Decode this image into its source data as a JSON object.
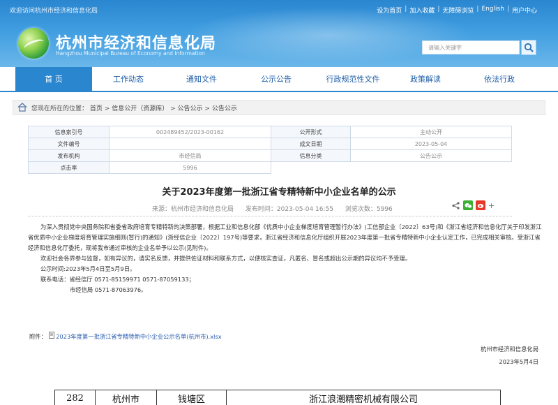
{
  "header": {
    "welcome": "欢迎访问杭州市经济和信息化局",
    "top_links": [
      "设为首页",
      "加入收藏",
      "无障碍浏览",
      "English",
      "用户中心"
    ],
    "title": "杭州市经济和信息化局",
    "subtitle": "Hangzhou Municipal Bureau of Economy and Information",
    "search_placeholder": "请输入关键字",
    "colors": {
      "header": "#2a86cf",
      "nav_active": "#2a86cf",
      "nav_text": "#1f5fa8"
    }
  },
  "nav": {
    "items": [
      "首 页",
      "工作动态",
      "通知文件",
      "公示公告",
      "行政规范性文件",
      "政策解读",
      "依法行政"
    ],
    "active_index": 0
  },
  "breadcrumb": {
    "prefix": "您现在所在的位置：",
    "crumbs": [
      "首页",
      "信息公开（资源库）",
      "公告公示",
      "公告公示"
    ],
    "separator": ">"
  },
  "info_table": {
    "index_label": "信息索引号",
    "index_value": "002489452/2023-00162",
    "form_label": "公开形式",
    "form_value": "主动公开",
    "docno_label": "文件编号",
    "docno_value": "",
    "date_label": "成文日期",
    "date_value": "2023-05-04",
    "org_label": "发布机构",
    "org_value": "市经信局",
    "cat_label": "信息分类",
    "cat_value": "公告公示",
    "hits_label": "点击率",
    "hits_value": "5996"
  },
  "article": {
    "title": "关于2023年度第一批浙江省专精特新中小企业名单的公示",
    "source": "来源：杭州市经济和信息化局",
    "published": "发布时间：2023-05-04 16:55",
    "views": "浏览次数：5996",
    "para1": "为深入贯彻党中央国务院和省委省政府培育专精特新的决策部署，根据工业和信息化部《优质中小企业梯度培育管理暂行办法》(工信部企业〔2022〕63号)和《浙江省经济和信息化厅关于印发浙江省优质中小企业梯度培育管理实施细则(暂行)的通知》(浙经信企业〔2022〕197号)等要求，浙江省经济和信息化厅组织开展2023年度第一批省专精特新中小企业认定工作，已完成相关审核。受浙江省经济和信息化厅委托，现将我市通过审核的企业名单予以公示(见附件)。",
    "para2": "欢迎社会各界参与监督，如有异议的，请实名反馈，并提供佐证材料和联系方式，以便核实查证。凡匿名、冒名或超出公示期的异议均不予受理。",
    "period": "公示时间:2023年5月4日至5月9日。",
    "contact1": "联系电话：省经信厅 0571-85159971 0571-87059133；",
    "contact2": "市经信局 0571-87063976。",
    "attach_label": "附件：",
    "attach_name": "2023年度第一批浙江省专精特新中小企业公示名单(杭州市).xlsx",
    "sign_org": "杭州市经济和信息化局",
    "sign_date": "2023年5月4日"
  },
  "bottom_row": [
    "282",
    "杭州市",
    "钱塘区",
    "浙江浪潮精密机械有限公司"
  ]
}
